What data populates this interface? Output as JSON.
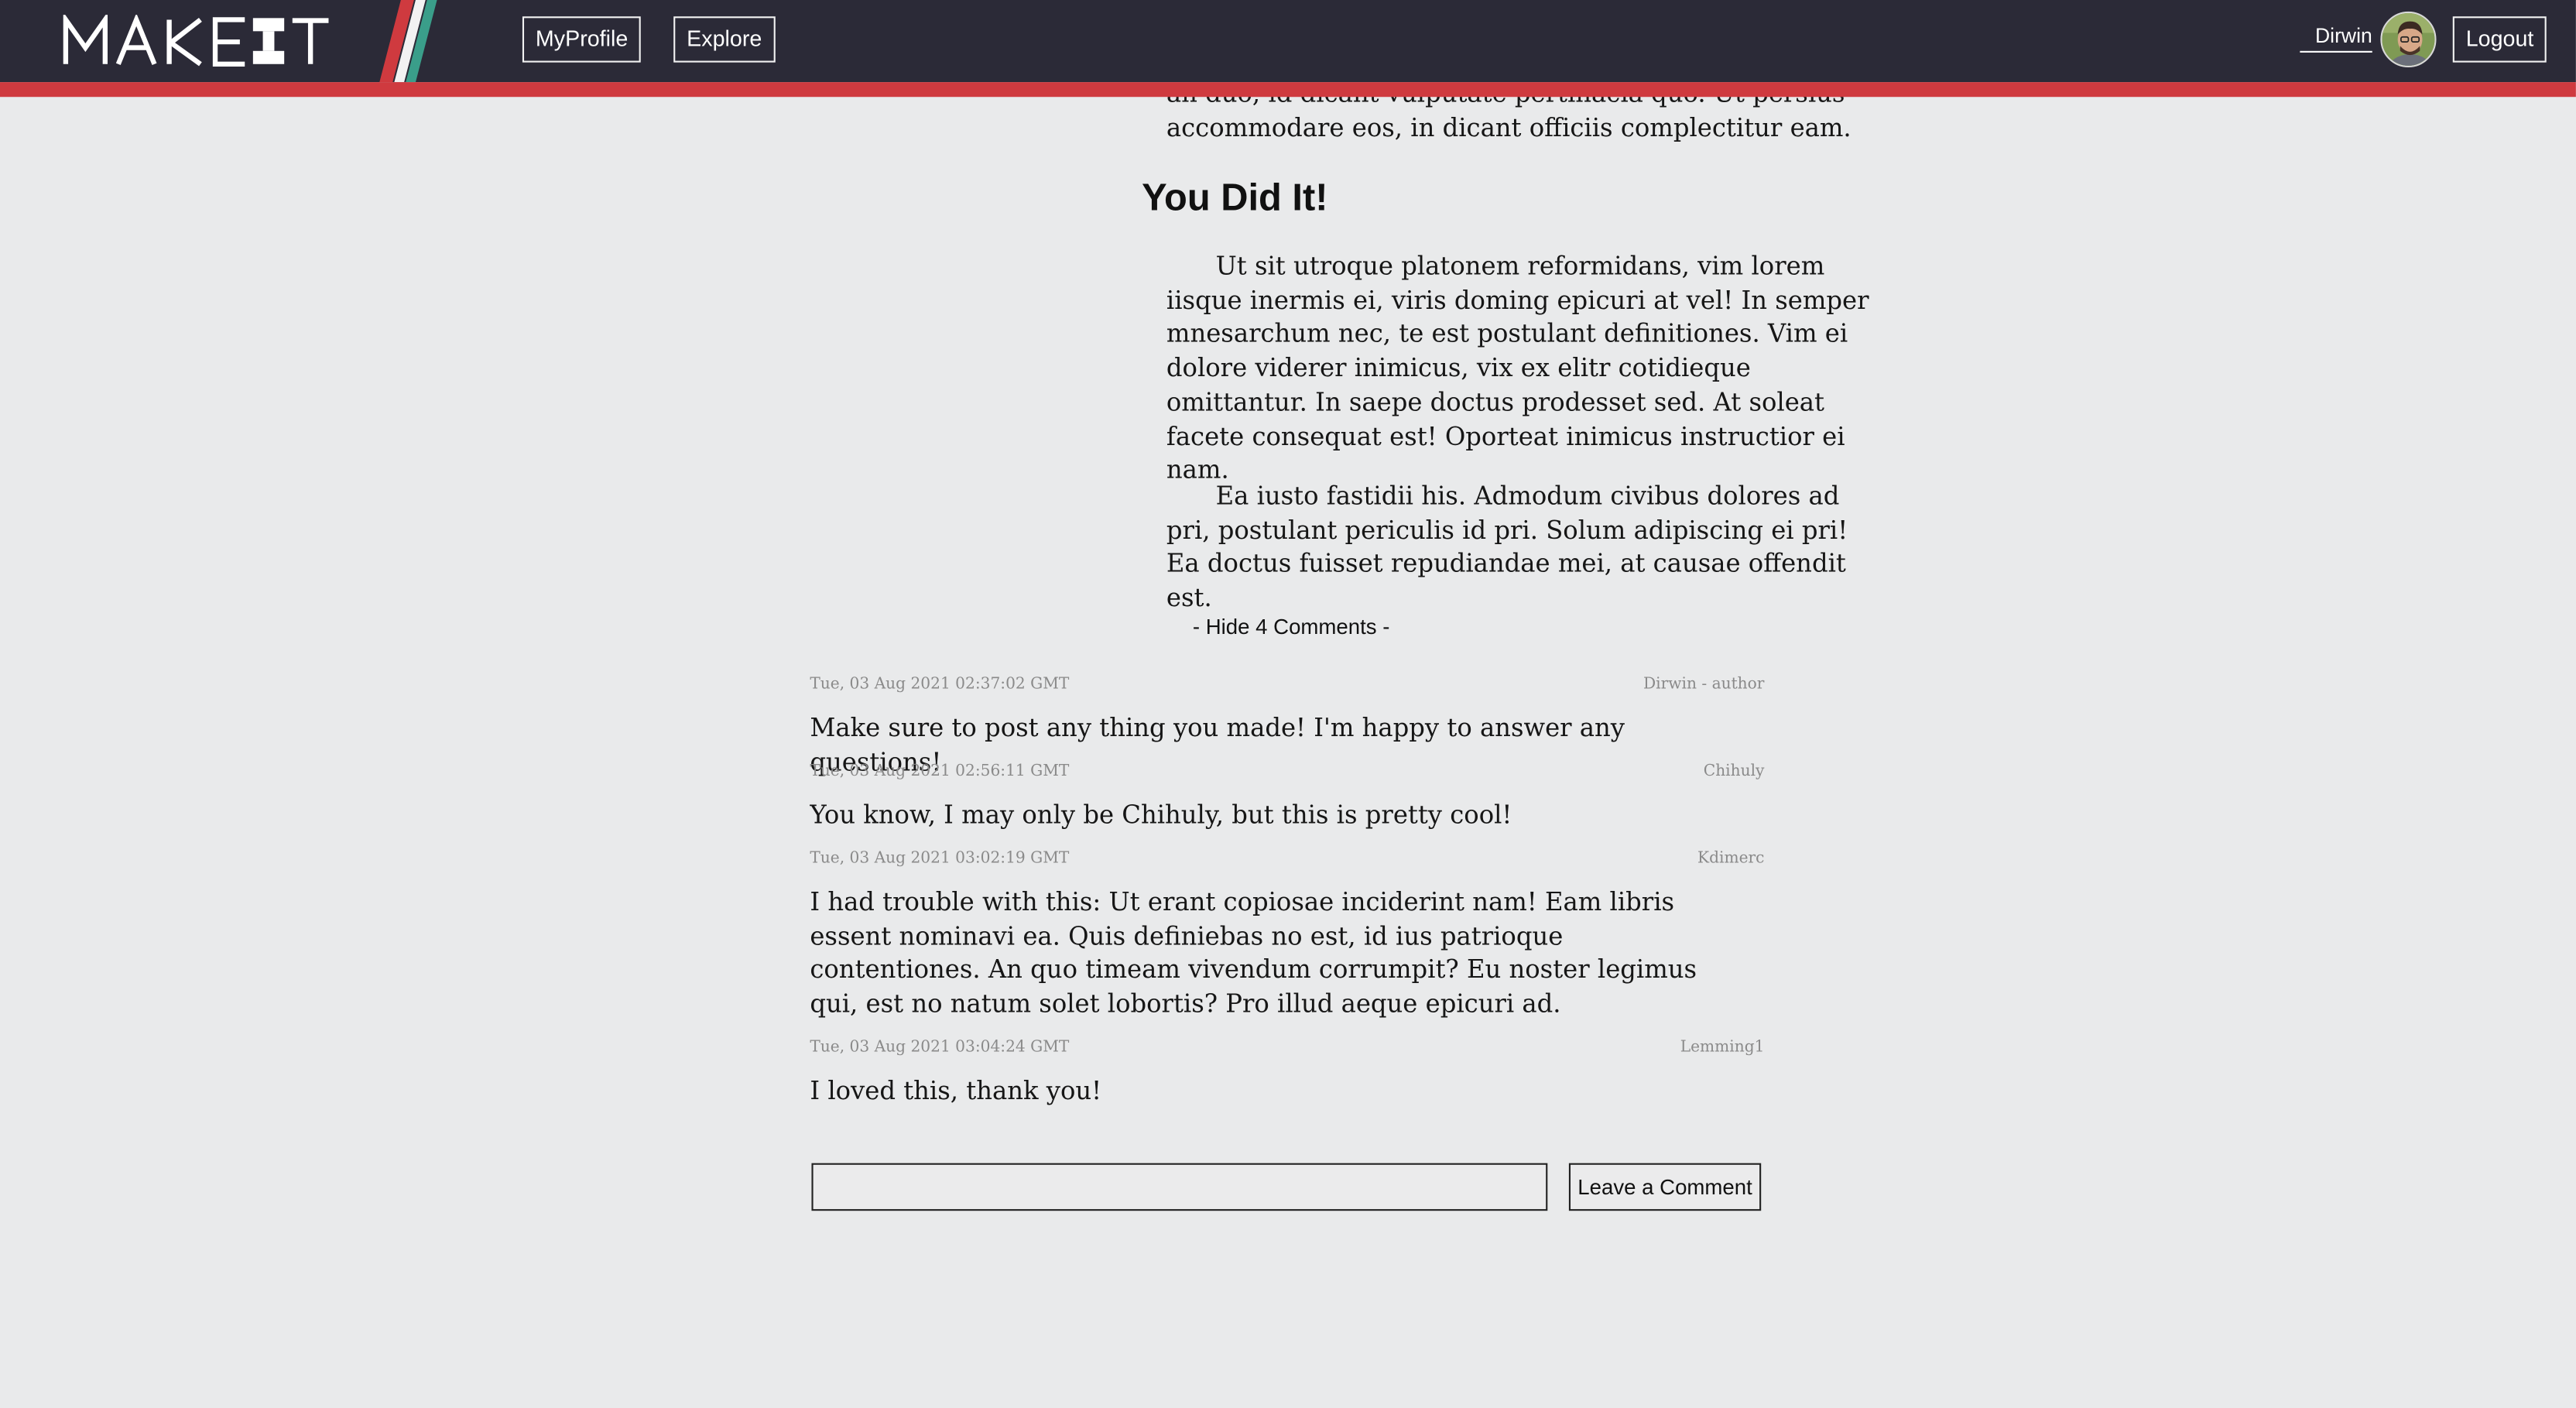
{
  "header": {
    "logo_text": "MAKEIT",
    "nav": [
      {
        "label": "MyProfile"
      },
      {
        "label": "Explore"
      }
    ],
    "user": {
      "name": "Dirwin",
      "avatar_icon": "user-avatar-icon"
    },
    "logout_label": "Logout",
    "colors": {
      "bar": "#2b2a37",
      "accent_red": "#cf3a3f",
      "stripe_teal": "#3a9e8a",
      "stripe_white": "#f2f2f2"
    }
  },
  "article": {
    "partial_top_line_1": "an duo, id dicant vulputate pertinacia quo. Ut persius",
    "partial_top_line_2": "accommodare eos, in dicant officiis complectitur eam.",
    "section_title": "You Did It!",
    "paragraphs": [
      "Ut sit utroque platonem reformidans, vim lorem iisque inermis ei, viris doming epicuri at vel! In semper mnesarchum nec, te est postulant definitiones. Vim ei dolore viderer inimicus, vix ex elitr cotidieque omittantur. In saepe doctus prodesset sed. At soleat facete consequat est! Oporteat inimicus instructior ei nam.",
      "Ea iusto fastidii his. Admodum civibus dolores ad pri, postulant periculis id pri. Solum adipiscing ei pri! Ea doctus fuisset repudiandae mei, at causae offendit est."
    ]
  },
  "comments": {
    "toggle_label": "- Hide 4 Comments -",
    "items": [
      {
        "date": "Tue, 03 Aug 2021 02:37:02 GMT",
        "author": "Dirwin - author",
        "text": "Make sure to post any thing you made! I'm happy to answer any questions!"
      },
      {
        "date": "Tue, 03 Aug 2021 02:56:11 GMT",
        "author": "Chihuly",
        "text": "You know, I may only be Chihuly, but this is pretty cool!"
      },
      {
        "date": "Tue, 03 Aug 2021 03:02:19 GMT",
        "author": "Kdimerc",
        "text": "I had trouble with this: Ut erant copiosae inciderint nam! Eam libris essent nominavi ea. Quis definiebas no est, id ius patrioque contentiones. An quo timeam vivendum corrumpit? Eu noster legimus qui, est no natum solet lobortis? Pro illud aeque epicuri ad."
      },
      {
        "date": "Tue, 03 Aug 2021 03:04:24 GMT",
        "author": "Lemming1",
        "text": "I loved this, thank you!"
      }
    ],
    "input_value": "",
    "input_placeholder": "",
    "submit_label": "Leave a Comment"
  }
}
